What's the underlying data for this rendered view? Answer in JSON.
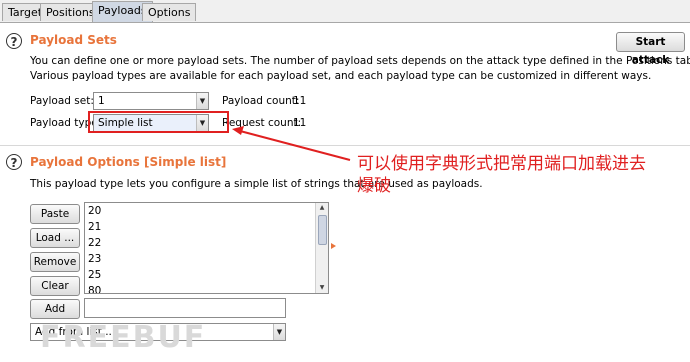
{
  "tabs": [
    "Target",
    "Positions",
    "Payloads",
    "Options"
  ],
  "payload_sets": {
    "title": "Payload Sets",
    "desc_line1": "You can define one or more payload sets. The number of payload sets depends on the attack type defined in the Positions tab.",
    "desc_line2": "Various payload types are available for each payload set, and each payload type can be customized in different ways.",
    "set_label": "Payload set:",
    "set_value": "1",
    "count_label": "Payload count:",
    "count_value": "11",
    "type_label": "Payload type:",
    "type_value": "Simple list",
    "request_label": "Request count:",
    "request_value": "11",
    "start_attack": "Start attack"
  },
  "payload_options": {
    "title": "Payload Options [Simple list]",
    "desc": "This payload type lets you configure a simple list of strings that are used as payloads.",
    "buttons": {
      "paste": "Paste",
      "load": "Load ...",
      "remove": "Remove",
      "clear": "Clear",
      "add": "Add"
    },
    "list_items": [
      "20",
      "21",
      "22",
      "23",
      "25",
      "80"
    ],
    "add_from_list": "Add from list ..."
  },
  "annotation": {
    "line1": "可以使用字典形式把常用端口加载进去",
    "line2": "爆破",
    "color": "#e02020"
  },
  "watermark": "FREEBUF",
  "colors": {
    "section_title": "#e8743b",
    "active_tab": "#d0d8e4"
  }
}
